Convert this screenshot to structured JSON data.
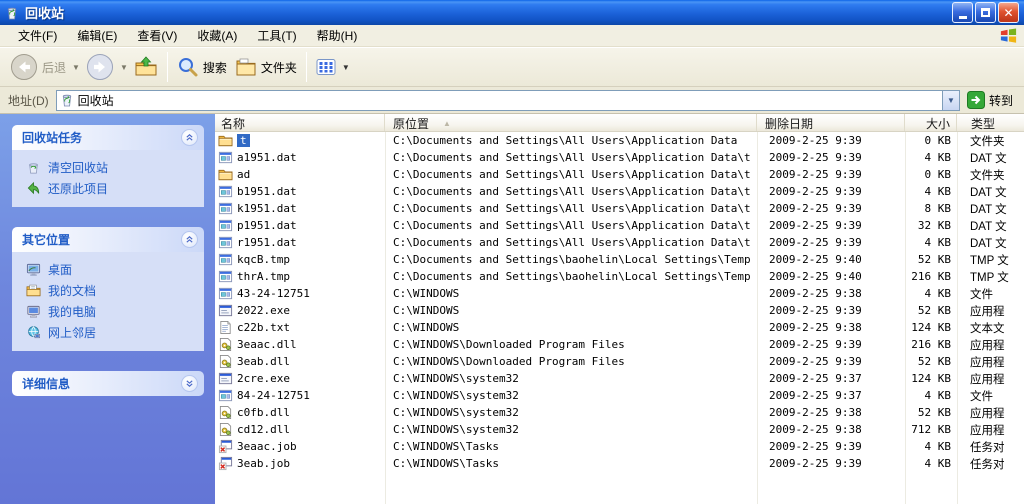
{
  "window": {
    "title": "回收站"
  },
  "menu": {
    "items": [
      "文件(F)",
      "编辑(E)",
      "查看(V)",
      "收藏(A)",
      "工具(T)",
      "帮助(H)"
    ]
  },
  "toolbar": {
    "back": "后退",
    "search": "搜索",
    "folders": "文件夹"
  },
  "address": {
    "label": "地址(D)",
    "value": "回收站",
    "go": "转到"
  },
  "sidebar": {
    "panels": [
      {
        "title": "回收站任务",
        "collapsed": false,
        "items": [
          {
            "icon": "empty-recycle-bin-icon",
            "label": "清空回收站"
          },
          {
            "icon": "restore-item-icon",
            "label": "还原此项目"
          }
        ]
      },
      {
        "title": "其它位置",
        "collapsed": false,
        "items": [
          {
            "icon": "desktop-icon",
            "label": "桌面"
          },
          {
            "icon": "my-documents-icon",
            "label": "我的文档"
          },
          {
            "icon": "my-computer-icon",
            "label": "我的电脑"
          },
          {
            "icon": "network-places-icon",
            "label": "网上邻居"
          }
        ]
      },
      {
        "title": "详细信息",
        "collapsed": true,
        "items": []
      }
    ]
  },
  "list": {
    "columns": [
      {
        "id": "name",
        "label": "名称",
        "sorted": false
      },
      {
        "id": "location",
        "label": "原位置",
        "sorted": true
      },
      {
        "id": "date",
        "label": "删除日期",
        "sorted": false
      },
      {
        "id": "size",
        "label": "大小",
        "sorted": false
      },
      {
        "id": "type",
        "label": "类型",
        "sorted": false
      }
    ],
    "rows": [
      {
        "name": "t",
        "icon": "folder-icon",
        "location": "C:\\Documents and Settings\\All Users\\Application Data",
        "date": "2009-2-25 9:39",
        "size": "0 KB",
        "type": "文件夹",
        "selected": true
      },
      {
        "name": "a1951.dat",
        "icon": "dat-file-icon",
        "location": "C:\\Documents and Settings\\All Users\\Application Data\\t",
        "date": "2009-2-25 9:39",
        "size": "4 KB",
        "type": "DAT 文",
        "selected": false
      },
      {
        "name": "ad",
        "icon": "folder-icon",
        "location": "C:\\Documents and Settings\\All Users\\Application Data\\t",
        "date": "2009-2-25 9:39",
        "size": "0 KB",
        "type": "文件夹",
        "selected": false
      },
      {
        "name": "b1951.dat",
        "icon": "dat-file-icon",
        "location": "C:\\Documents and Settings\\All Users\\Application Data\\t",
        "date": "2009-2-25 9:39",
        "size": "4 KB",
        "type": "DAT 文",
        "selected": false
      },
      {
        "name": "k1951.dat",
        "icon": "dat-file-icon",
        "location": "C:\\Documents and Settings\\All Users\\Application Data\\t",
        "date": "2009-2-25 9:39",
        "size": "8 KB",
        "type": "DAT 文",
        "selected": false
      },
      {
        "name": "p1951.dat",
        "icon": "dat-file-icon",
        "location": "C:\\Documents and Settings\\All Users\\Application Data\\t",
        "date": "2009-2-25 9:39",
        "size": "32 KB",
        "type": "DAT 文",
        "selected": false
      },
      {
        "name": "r1951.dat",
        "icon": "dat-file-icon",
        "location": "C:\\Documents and Settings\\All Users\\Application Data\\t",
        "date": "2009-2-25 9:39",
        "size": "4 KB",
        "type": "DAT 文",
        "selected": false
      },
      {
        "name": "kqcB.tmp",
        "icon": "dat-file-icon",
        "location": "C:\\Documents and Settings\\baohelin\\Local Settings\\Temp",
        "date": "2009-2-25 9:40",
        "size": "52 KB",
        "type": "TMP 文",
        "selected": false
      },
      {
        "name": "thrA.tmp",
        "icon": "dat-file-icon",
        "location": "C:\\Documents and Settings\\baohelin\\Local Settings\\Temp",
        "date": "2009-2-25 9:40",
        "size": "216 KB",
        "type": "TMP 文",
        "selected": false
      },
      {
        "name": "43-24-12751",
        "icon": "dat-file-icon",
        "location": "C:\\WINDOWS",
        "date": "2009-2-25 9:38",
        "size": "4 KB",
        "type": "文件",
        "selected": false
      },
      {
        "name": "2022.exe",
        "icon": "app-window-icon",
        "location": "C:\\WINDOWS",
        "date": "2009-2-25 9:39",
        "size": "52 KB",
        "type": "应用程",
        "selected": false
      },
      {
        "name": "c22b.txt",
        "icon": "text-file-icon",
        "location": "C:\\WINDOWS",
        "date": "2009-2-25 9:38",
        "size": "124 KB",
        "type": "文本文",
        "selected": false
      },
      {
        "name": "3eaac.dll",
        "icon": "dll-file-icon",
        "location": "C:\\WINDOWS\\Downloaded Program Files",
        "date": "2009-2-25 9:39",
        "size": "216 KB",
        "type": "应用程",
        "selected": false
      },
      {
        "name": "3eab.dll",
        "icon": "dll-file-icon",
        "location": "C:\\WINDOWS\\Downloaded Program Files",
        "date": "2009-2-25 9:39",
        "size": "52 KB",
        "type": "应用程",
        "selected": false
      },
      {
        "name": "2cre.exe",
        "icon": "app-window-icon",
        "location": "C:\\WINDOWS\\system32",
        "date": "2009-2-25 9:37",
        "size": "124 KB",
        "type": "应用程",
        "selected": false
      },
      {
        "name": "84-24-12751",
        "icon": "dat-file-icon",
        "location": "C:\\WINDOWS\\system32",
        "date": "2009-2-25 9:37",
        "size": "4 KB",
        "type": "文件",
        "selected": false
      },
      {
        "name": "c0fb.dll",
        "icon": "dll-file-icon",
        "location": "C:\\WINDOWS\\system32",
        "date": "2009-2-25 9:38",
        "size": "52 KB",
        "type": "应用程",
        "selected": false
      },
      {
        "name": "cd12.dll",
        "icon": "dll-file-icon",
        "location": "C:\\WINDOWS\\system32",
        "date": "2009-2-25 9:38",
        "size": "712 KB",
        "type": "应用程",
        "selected": false
      },
      {
        "name": "3eaac.job",
        "icon": "job-file-icon",
        "location": "C:\\WINDOWS\\Tasks",
        "date": "2009-2-25 9:39",
        "size": "4 KB",
        "type": "任务对",
        "selected": false
      },
      {
        "name": "3eab.job",
        "icon": "job-file-icon",
        "location": "C:\\WINDOWS\\Tasks",
        "date": "2009-2-25 9:39",
        "size": "4 KB",
        "type": "任务对",
        "selected": false
      }
    ]
  }
}
